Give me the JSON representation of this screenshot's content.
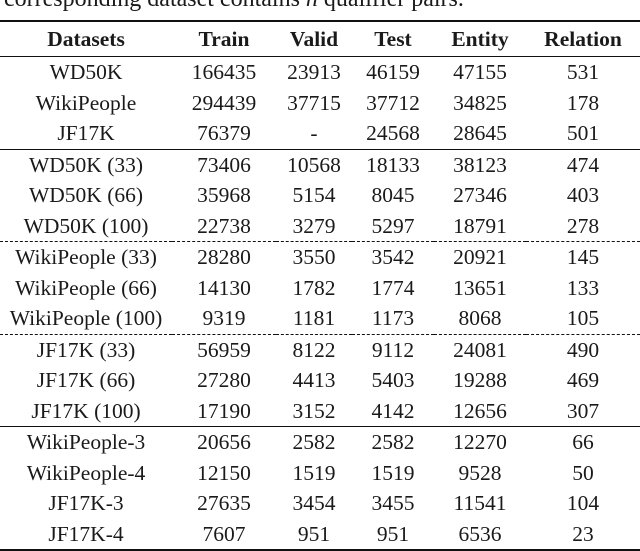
{
  "caption": {
    "prefix": "corresponding dataset contains ",
    "italic": "n",
    "suffix": " qualifier pairs."
  },
  "table": {
    "headers": [
      "Datasets",
      "Train",
      "Valid",
      "Test",
      "Entity",
      "Relation"
    ],
    "groups": [
      {
        "separator": "solid",
        "rows": [
          [
            "WD50K",
            "166435",
            "23913",
            "46159",
            "47155",
            "531"
          ],
          [
            "WikiPeople",
            "294439",
            "37715",
            "37712",
            "34825",
            "178"
          ],
          [
            "JF17K",
            "76379",
            "-",
            "24568",
            "28645",
            "501"
          ]
        ]
      },
      {
        "separator": "solid",
        "rows": [
          [
            "WD50K (33)",
            "73406",
            "10568",
            "18133",
            "38123",
            "474"
          ],
          [
            "WD50K (66)",
            "35968",
            "5154",
            "8045",
            "27346",
            "403"
          ],
          [
            "WD50K (100)",
            "22738",
            "3279",
            "5297",
            "18791",
            "278"
          ]
        ]
      },
      {
        "separator": "dashed",
        "rows": [
          [
            "WikiPeople (33)",
            "28280",
            "3550",
            "3542",
            "20921",
            "145"
          ],
          [
            "WikiPeople (66)",
            "14130",
            "1782",
            "1774",
            "13651",
            "133"
          ],
          [
            "WikiPeople (100)",
            "9319",
            "1181",
            "1173",
            "8068",
            "105"
          ]
        ]
      },
      {
        "separator": "dashed",
        "rows": [
          [
            "JF17K (33)",
            "56959",
            "8122",
            "9112",
            "24081",
            "490"
          ],
          [
            "JF17K (66)",
            "27280",
            "4413",
            "5403",
            "19288",
            "469"
          ],
          [
            "JF17K (100)",
            "17190",
            "3152",
            "4142",
            "12656",
            "307"
          ]
        ]
      },
      {
        "separator": "solid",
        "rows": [
          [
            "WikiPeople-3",
            "20656",
            "2582",
            "2582",
            "12270",
            "66"
          ],
          [
            "WikiPeople-4",
            "12150",
            "1519",
            "1519",
            "9528",
            "50"
          ],
          [
            "JF17K-3",
            "27635",
            "3454",
            "3455",
            "11541",
            "104"
          ],
          [
            "JF17K-4",
            "7607",
            "951",
            "951",
            "6536",
            "23"
          ]
        ]
      }
    ]
  }
}
